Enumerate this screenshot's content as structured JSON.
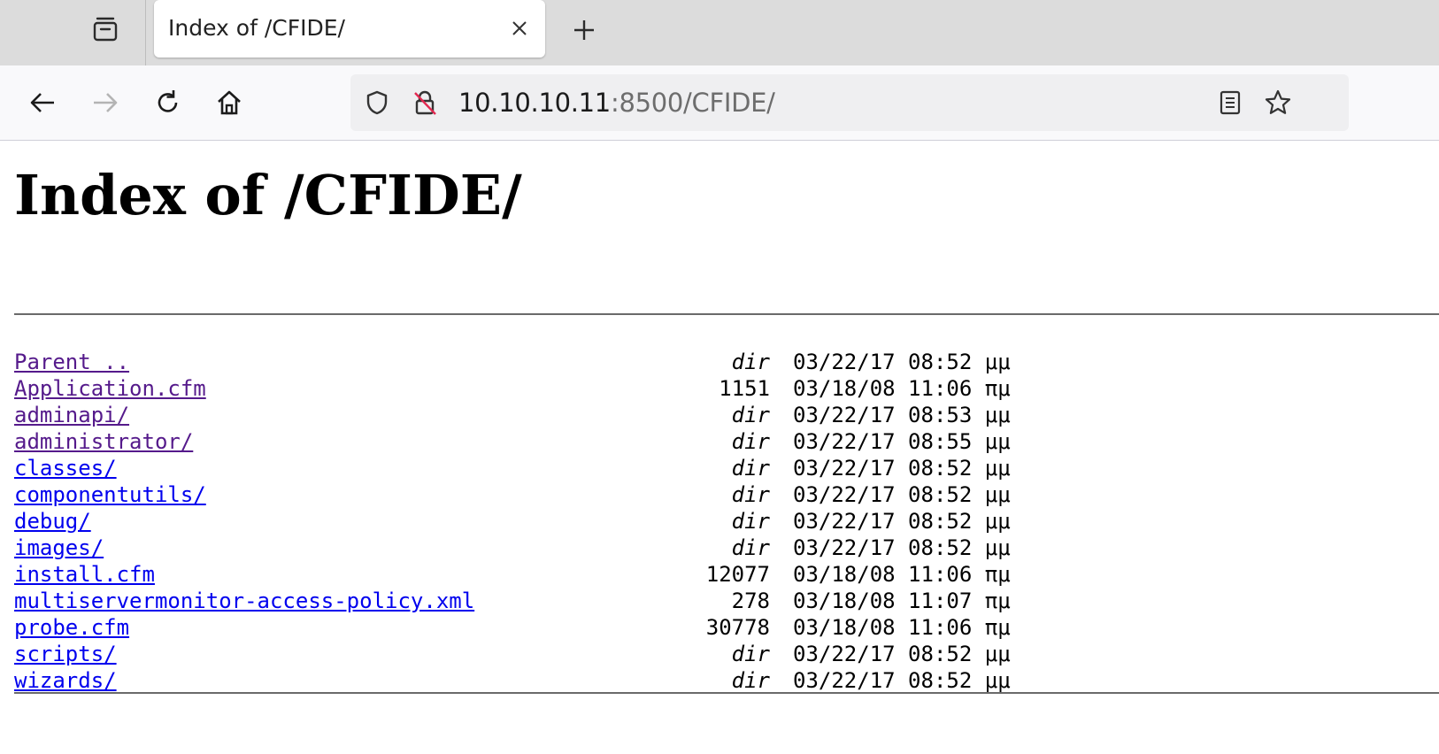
{
  "browser": {
    "tab_title": "Index of /CFIDE/",
    "url_host": "10.10.10.11",
    "url_rest": ":8500/CFIDE/"
  },
  "page": {
    "heading": "Index of /CFIDE/",
    "entries": [
      {
        "name": "Parent ..",
        "size": "dir",
        "date": "03/22/17 08:52 μμ",
        "visited": true
      },
      {
        "name": "Application.cfm",
        "size": "1151",
        "date": "03/18/08 11:06 πμ",
        "visited": true
      },
      {
        "name": "adminapi/",
        "size": "dir",
        "date": "03/22/17 08:53 μμ",
        "visited": true
      },
      {
        "name": "administrator/",
        "size": "dir",
        "date": "03/22/17 08:55 μμ",
        "visited": true
      },
      {
        "name": "classes/",
        "size": "dir",
        "date": "03/22/17 08:52 μμ",
        "visited": false
      },
      {
        "name": "componentutils/",
        "size": "dir",
        "date": "03/22/17 08:52 μμ",
        "visited": false
      },
      {
        "name": "debug/",
        "size": "dir",
        "date": "03/22/17 08:52 μμ",
        "visited": false
      },
      {
        "name": "images/",
        "size": "dir",
        "date": "03/22/17 08:52 μμ",
        "visited": false
      },
      {
        "name": "install.cfm",
        "size": "12077",
        "date": "03/18/08 11:06 πμ",
        "visited": false
      },
      {
        "name": "multiservermonitor-access-policy.xml",
        "size": "278",
        "date": "03/18/08 11:07 πμ",
        "visited": false
      },
      {
        "name": "probe.cfm",
        "size": "30778",
        "date": "03/18/08 11:06 πμ",
        "visited": false
      },
      {
        "name": "scripts/",
        "size": "dir",
        "date": "03/22/17 08:52 μμ",
        "visited": false
      },
      {
        "name": "wizards/",
        "size": "dir",
        "date": "03/22/17 08:52 μμ",
        "visited": false
      }
    ]
  },
  "colors": {
    "link": "#0000ee",
    "visited_link": "#551a8b"
  }
}
